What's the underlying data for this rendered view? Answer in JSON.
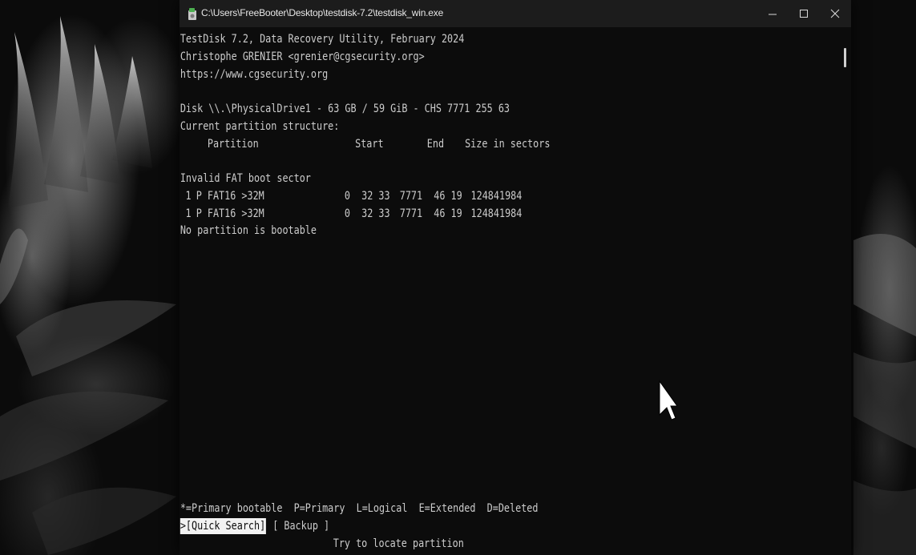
{
  "window": {
    "title": "C:\\Users\\FreeBooter\\Desktop\\testdisk-7.2\\testdisk_win.exe",
    "icon": "testdisk-app-icon",
    "controls": {
      "minimize": "minimize-icon",
      "maximize": "maximize-icon",
      "close": "close-icon"
    }
  },
  "console": {
    "header": [
      "TestDisk 7.2, Data Recovery Utility, February 2024",
      "Christophe GRENIER <grenier@cgsecurity.org>",
      "https://www.cgsecurity.org"
    ],
    "disk_line": "Disk \\\\.\\PhysicalDrive1 - 63 GB / 59 GiB - CHS 7771 255 63",
    "structure_label": "Current partition structure:",
    "columns": {
      "partition": "Partition",
      "start": "Start",
      "end": "End",
      "size": "Size in sectors"
    },
    "warning": "Invalid FAT boot sector",
    "partitions": [
      {
        "num": "1",
        "flag": "P",
        "type": "FAT16 >32M",
        "start": "0  32 33",
        "end": "7771  46 19",
        "size": "124841984"
      },
      {
        "num": "1",
        "flag": "P",
        "type": "FAT16 >32M",
        "start": "0  32 33",
        "end": "7771  46 19",
        "size": "124841984"
      }
    ],
    "boot_status": "No partition is bootable",
    "legend": "*=Primary bootable  P=Primary  L=Logical  E=Extended  D=Deleted",
    "menu": {
      "quick_search": ">[Quick Search]",
      "backup": "[ Backup ]"
    },
    "hint": "Try to locate partition"
  },
  "colors": {
    "console_bg": "#0c0c0c",
    "console_text": "#cccccc",
    "titlebar_bg": "#1c1c1c",
    "selection_bg": "#f2f2f2"
  }
}
